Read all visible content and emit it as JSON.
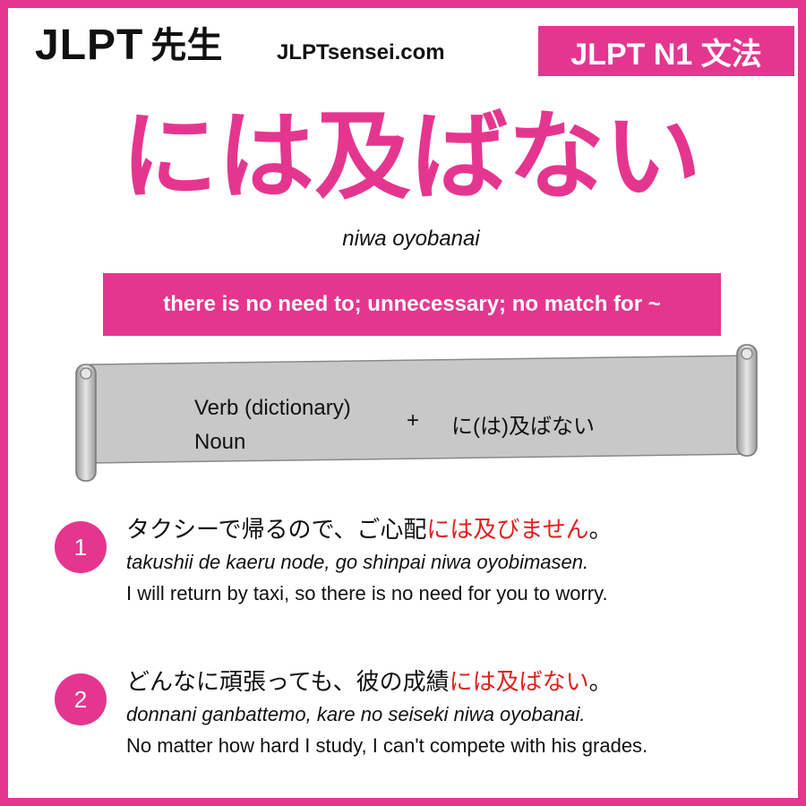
{
  "header": {
    "logo_text": "JLPT",
    "logo_kanji": "先生",
    "site": "JLPTsensei.com",
    "level_badge": "JLPT N1 文法"
  },
  "grammar": {
    "title": "には及ばない",
    "romaji": "niwa oyobanai",
    "meaning": "there is no need to; unnecessary; no match for ~"
  },
  "formula": {
    "line1": "Verb (dictionary)",
    "line2": "Noun",
    "plus": "+",
    "pattern": "に(は)及ばない"
  },
  "examples": [
    {
      "number": "1",
      "jp_before": "タクシーで帰るので、ご心配",
      "jp_highlight": "には及びません",
      "jp_after": "。",
      "romaji": "takushii de kaeru node, go shinpai niwa oyobimasen.",
      "english": "I will return by taxi, so there is no need for you to worry."
    },
    {
      "number": "2",
      "jp_before": "どんなに頑張っても、彼の成績",
      "jp_highlight": "には及ばない",
      "jp_after": "。",
      "romaji": "donnani ganbattemo, kare no seiseki niwa oyobanai.",
      "english": "No matter how hard I study, I can't compete with his grades."
    }
  ],
  "colors": {
    "brand_pink": "#e5368f",
    "highlight_red": "#e0211e",
    "scroll_gray": "#c8c8c8"
  }
}
